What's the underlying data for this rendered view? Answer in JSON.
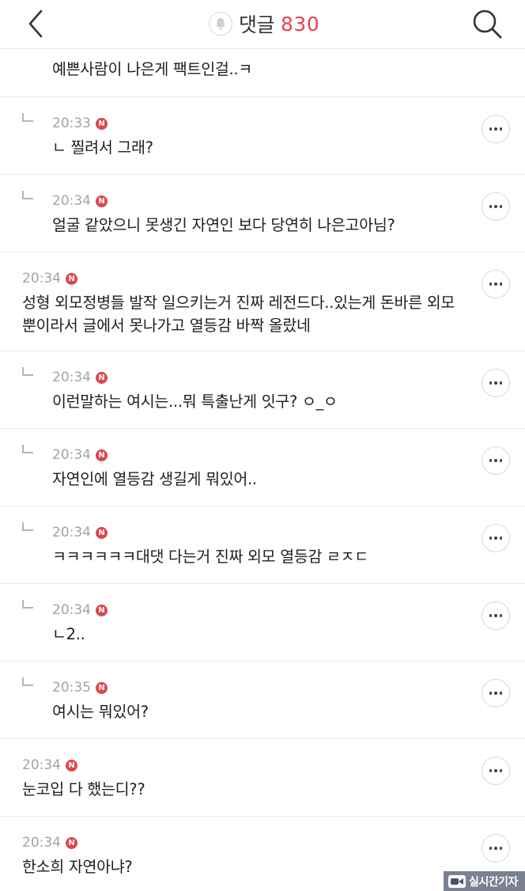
{
  "header": {
    "back_icon": "chevron-left-icon",
    "bell_icon": "bell-icon",
    "title": "댓글",
    "count": "830",
    "search_icon": "search-icon",
    "accent_color": "#e8434c"
  },
  "comments": [
    {
      "reply": false,
      "time": "",
      "badge": "",
      "text": "예쁜사람이 나은게 팩트인걸..ㅋ",
      "more": false
    },
    {
      "reply": true,
      "time": "20:33",
      "badge": "N",
      "text": "ㄴ 찔려서 그래?",
      "more": true
    },
    {
      "reply": true,
      "time": "20:34",
      "badge": "N",
      "text": "얼굴 같았으니 못생긴 자연인 보다 당연히 나은고아님?",
      "more": true
    },
    {
      "reply": false,
      "time": "20:34",
      "badge": "N",
      "text_line1": "성형 외모정병들 발작 일으키는거 진짜 레전드다..있는게 돈바른 외모",
      "text_line2": "뿐이라서 글에서 못나가고 열등감 바짝 올랐네",
      "more": true
    },
    {
      "reply": true,
      "time": "20:34",
      "badge": "N",
      "text": "이런말하는 여시는...뭐 특출난게 잇구? ㅇ_ㅇ",
      "more": true
    },
    {
      "reply": true,
      "time": "20:34",
      "badge": "N",
      "text": "자연인에 열등감 생길게 뭐있어..",
      "more": true
    },
    {
      "reply": true,
      "time": "20:34",
      "badge": "N",
      "text": "ㅋㅋㅋㅋㅋㅋ대댓 다는거 진짜 외모 열등감 ㄹㅈㄷ",
      "more": true
    },
    {
      "reply": true,
      "time": "20:34",
      "badge": "N",
      "text": "ㄴ2..",
      "more": true
    },
    {
      "reply": true,
      "time": "20:35",
      "badge": "N",
      "text": "여시는 뭐있어?",
      "more": true
    },
    {
      "reply": false,
      "time": "20:34",
      "badge": "N",
      "text": "눈코입 다 했는디??",
      "more": true
    },
    {
      "reply": false,
      "time": "20:34",
      "badge": "N",
      "text": "한소희 자연아냐?",
      "more": true
    }
  ],
  "watermark": {
    "text": "실시간기자"
  }
}
